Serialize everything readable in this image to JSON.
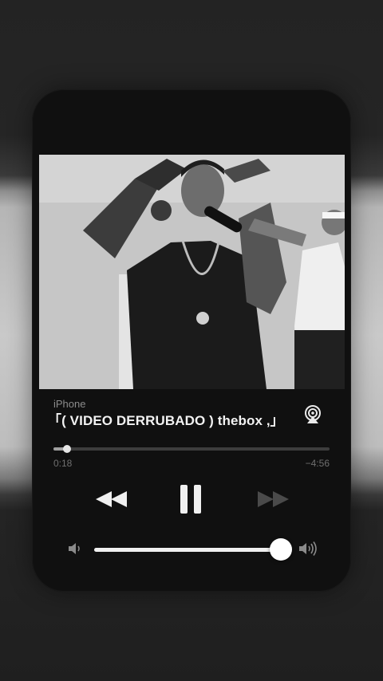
{
  "player": {
    "source_label": "iPhone",
    "title": "「( VIDEO DERRUBADO ) thebox ,」",
    "elapsed": "0:18",
    "remaining": "−4:56",
    "progress_fraction": 0.05,
    "playing": true,
    "volume_fraction": 1.0
  },
  "controls": {
    "rewind": "rewind-icon",
    "pause": "pause-icon",
    "forward": "fast-forward-icon",
    "airplay": "airplay-icon",
    "volume_low": "speaker-low-icon",
    "volume_high": "speaker-high-icon"
  },
  "colors": {
    "card": "#101010",
    "accent": "#ffffff",
    "disabled": "#4a4a4a"
  }
}
